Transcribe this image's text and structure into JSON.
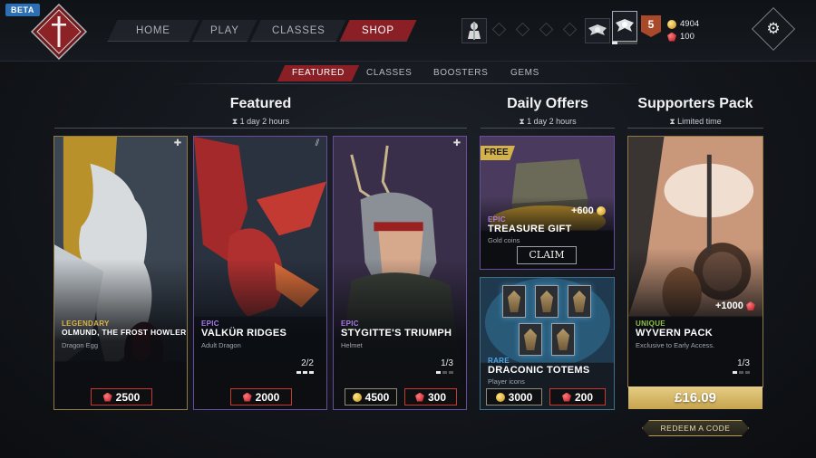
{
  "badge": "BETA",
  "nav": {
    "items": [
      {
        "label": "HOME"
      },
      {
        "label": "PLAY"
      },
      {
        "label": "CLASSES"
      },
      {
        "label": "SHOP"
      }
    ],
    "active": "SHOP"
  },
  "player": {
    "level": "5",
    "gold": "4904",
    "gems": "100"
  },
  "subtabs": {
    "items": [
      {
        "label": "FEATURED"
      },
      {
        "label": "CLASSES"
      },
      {
        "label": "BOOSTERS"
      },
      {
        "label": "GEMS"
      }
    ],
    "active": "FEATURED"
  },
  "sections": {
    "featured": {
      "title": "Featured",
      "timer": "1 day 2 hours"
    },
    "daily": {
      "title": "Daily Offers",
      "timer": "1 day 2 hours"
    },
    "supporters": {
      "title": "Supporters Pack",
      "timer": "Limited time"
    }
  },
  "cards": {
    "olmund": {
      "rarity": "LEGENDARY",
      "name": "OLMUND, THE FROST HOWLER - EGG",
      "type": "Dragon Egg",
      "gem_price": "2500",
      "rarity_color": "#d9b54a"
    },
    "valkur": {
      "rarity": "EPIC",
      "name": "VALKÜR RIDGES",
      "type": "Adult Dragon",
      "gem_price": "2000",
      "stock": "2/2",
      "stock_level": 1.0,
      "rarity_color": "#a878e8"
    },
    "stygitte": {
      "rarity": "EPIC",
      "name": "STYGITTE'S TRIUMPH",
      "type": "Helmet",
      "gold_price": "4500",
      "gem_price": "300",
      "stock": "1/3",
      "stock_level": 0.33,
      "rarity_color": "#a878e8"
    },
    "treasure": {
      "badge": "FREE",
      "rarity": "EPIC",
      "name": "TREASURE GIFT",
      "type": "Gold coins",
      "reward": "+600",
      "button": "CLAIM",
      "rarity_color": "#a878e8"
    },
    "totems": {
      "rarity": "RARE",
      "name": "DRACONIC TOTEMS",
      "type": "Player icons",
      "gold_price": "3000",
      "gem_price": "200",
      "rarity_color": "#4aa6e8"
    },
    "wyvern": {
      "rarity": "UNIQUE",
      "name": "WYVERN PACK",
      "type": "Exclusive to Early Access.",
      "reward": "+1000",
      "stock": "1/3",
      "stock_level": 0.33,
      "price": "£16.09",
      "rarity_color": "#8fc24a"
    }
  },
  "redeem_label": "REDEEM A CODE",
  "colors": {
    "accent_red": "#8a2026",
    "price_border_red": "#c63a32",
    "gold": "#d4b24a"
  }
}
